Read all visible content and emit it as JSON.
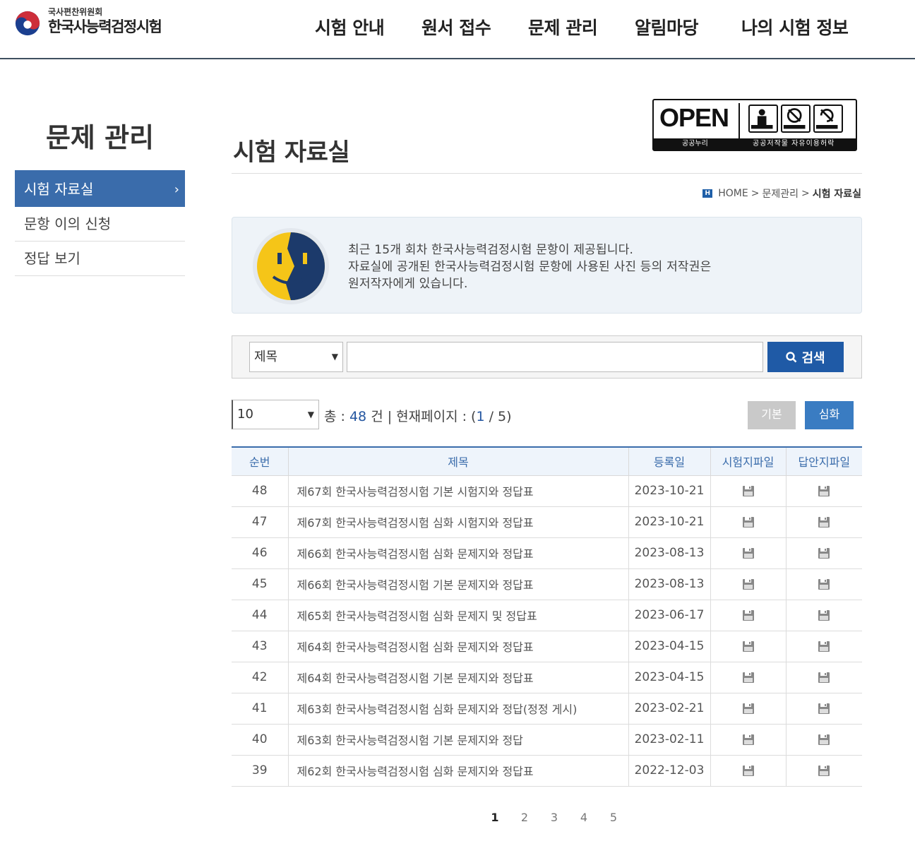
{
  "header": {
    "logo_small": "국사편찬위원회",
    "logo_big": "한국사능력검정시험",
    "nav": [
      "시험 안내",
      "원서 접수",
      "문제 관리",
      "알림마당",
      "나의 시험 정보"
    ]
  },
  "sidebar": {
    "title": "문제 관리",
    "items": [
      {
        "label": "시험 자료실",
        "active": true
      },
      {
        "label": "문항 이의 신청",
        "active": false
      },
      {
        "label": "정답 보기",
        "active": false
      }
    ],
    "active_chevron": "›"
  },
  "page": {
    "title": "시험 자료실"
  },
  "open_license": {
    "open_text": "OPEN",
    "strip_left": "공공누리",
    "strip_right": "공공저작물 자유이용허락",
    "icon_labels": [
      "출처표시",
      "상업용금지",
      "변경금지"
    ]
  },
  "breadcrumb": {
    "home_icon": "H",
    "home": "HOME",
    "section": "문제관리",
    "current": "시험 자료실",
    "separator": ">"
  },
  "notice": {
    "lines": [
      "최근 15개 회차 한국사능력검정시험 문항이 제공됩니다.",
      "자료실에 공개된 한국사능력검정시험 문항에 사용된 사진 등의 저작권은",
      "원저작자에게 있습니다."
    ]
  },
  "search": {
    "select_value": "제목",
    "input_value": "",
    "button_label": "검색",
    "arrow": "⌄"
  },
  "list_controls": {
    "page_size": "10",
    "count_prefix": "총 : ",
    "count_total": "48",
    "count_mid": " 건 | 현재페이지 : (",
    "current_page": "1",
    "count_sep": " / ",
    "total_pages": "5",
    "count_suffix": ")",
    "btn_basic": "기본",
    "btn_advanced": "심화"
  },
  "table": {
    "headers": [
      "순번",
      "제목",
      "등록일",
      "시험지파일",
      "답안지파일"
    ],
    "rows": [
      {
        "no": "48",
        "title": "제67회 한국사능력검정시험 기본 시험지와 정답표",
        "date": "2023-10-21"
      },
      {
        "no": "47",
        "title": "제67회 한국사능력검정시험 심화 시험지와 정답표",
        "date": "2023-10-21"
      },
      {
        "no": "46",
        "title": "제66회 한국사능력검정시험 심화 문제지와 정답표",
        "date": "2023-08-13"
      },
      {
        "no": "45",
        "title": "제66회 한국사능력검정시험 기본 문제지와 정답표",
        "date": "2023-08-13"
      },
      {
        "no": "44",
        "title": "제65회 한국사능력검정시험 심화 문제지 및 정답표",
        "date": "2023-06-17"
      },
      {
        "no": "43",
        "title": "제64회 한국사능력검정시험 심화 문제지와 정답표",
        "date": "2023-04-15"
      },
      {
        "no": "42",
        "title": "제64회 한국사능력검정시험 기본 문제지와 정답표",
        "date": "2023-04-15"
      },
      {
        "no": "41",
        "title": "제63회 한국사능력검정시험 심화 문제지와 정답(정정 게시)",
        "date": "2023-02-21"
      },
      {
        "no": "40",
        "title": "제63회 한국사능력검정시험 기본 문제지와 정답",
        "date": "2023-02-11"
      },
      {
        "no": "39",
        "title": "제62회 한국사능력검정시험 심화 문제지와 정답표",
        "date": "2022-12-03"
      }
    ]
  },
  "pagination": {
    "pages": [
      "1",
      "2",
      "3",
      "4",
      "5"
    ],
    "current": "1"
  },
  "colors": {
    "accent": "#3a6cab",
    "search_button": "#1f5aa6",
    "notice_bg": "#eef3f8"
  }
}
